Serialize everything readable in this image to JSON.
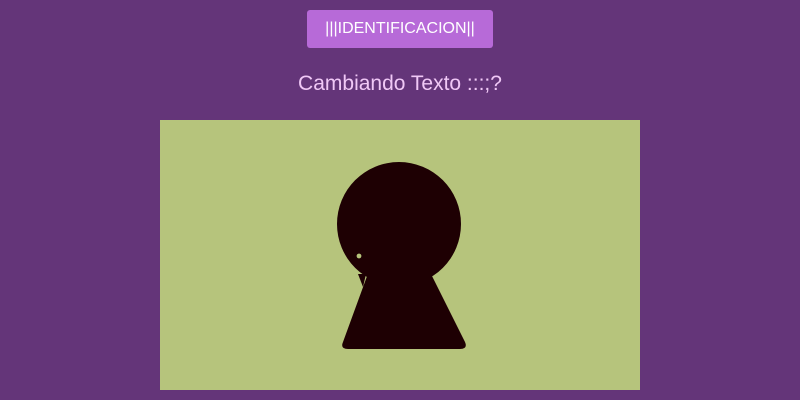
{
  "header": {
    "button_label": "|||IDENTIFICACION||",
    "subtitle": "Cambiando Texto :::;?"
  },
  "stage": {
    "background_color": "#b6c47c",
    "figure_color": "#1e0003",
    "figure": "keyhole-silhouette-icon"
  },
  "colors": {
    "page_background": "#643579",
    "button_background": "#b76ad8",
    "subtitle_color": "#f0c8f6"
  }
}
